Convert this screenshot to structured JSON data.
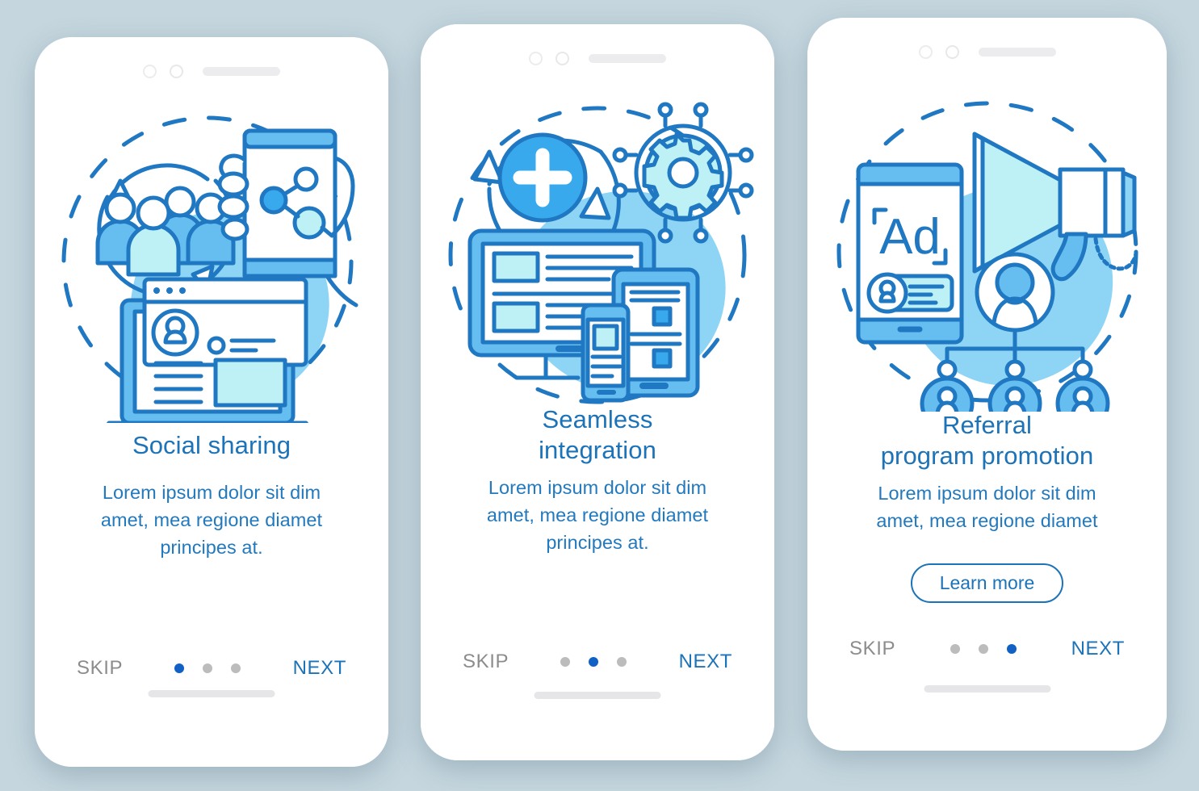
{
  "app": {
    "background_color": "#c5d6de",
    "card_color": "#ffffff",
    "title_color": "#1c73b8",
    "body_color": "#2279bd",
    "skip_color": "#8c8c8c",
    "dot_active_color": "#1160c4",
    "dot_inactive_color": "#bcbcbc"
  },
  "screens": [
    {
      "title": "Social sharing",
      "description": "Lorem ipsum dolor sit dim amet, mea regione diamet principes at.",
      "desc_lines": [
        "Lorem ipsum dolor sit dim",
        "amet, mea regione diamet",
        "principes at."
      ],
      "title_lines": [
        "Social sharing"
      ],
      "skip_label": "SKIP",
      "next_label": "NEXT",
      "active_dot": 1,
      "dot_count": 3,
      "illustration": "social-sharing-illustration",
      "has_learn_more": false
    },
    {
      "title": "Seamless integration",
      "description": "Lorem ipsum dolor sit dim amet, mea regione diamet principes at.",
      "desc_lines": [
        "Lorem ipsum dolor sit dim",
        "amet, mea regione diamet",
        "principes at."
      ],
      "title_lines": [
        "Seamless",
        "integration"
      ],
      "skip_label": "SKIP",
      "next_label": "NEXT",
      "active_dot": 2,
      "dot_count": 3,
      "illustration": "seamless-integration-illustration",
      "has_learn_more": false
    },
    {
      "title": "Referral program promotion",
      "description": "Lorem ipsum dolor sit dim amet, mea regione diamet",
      "desc_lines": [
        "Lorem ipsum dolor sit dim",
        "amet, mea regione diamet"
      ],
      "title_lines": [
        "Referral",
        "program promotion"
      ],
      "skip_label": "SKIP",
      "next_label": "NEXT",
      "learn_more_label": "Learn more",
      "active_dot": 3,
      "dot_count": 3,
      "illustration": "referral-promotion-illustration",
      "has_learn_more": true
    }
  ],
  "illustration_labels": {
    "screen1_ad_text": "",
    "screen3_ad_text": "Ad"
  }
}
